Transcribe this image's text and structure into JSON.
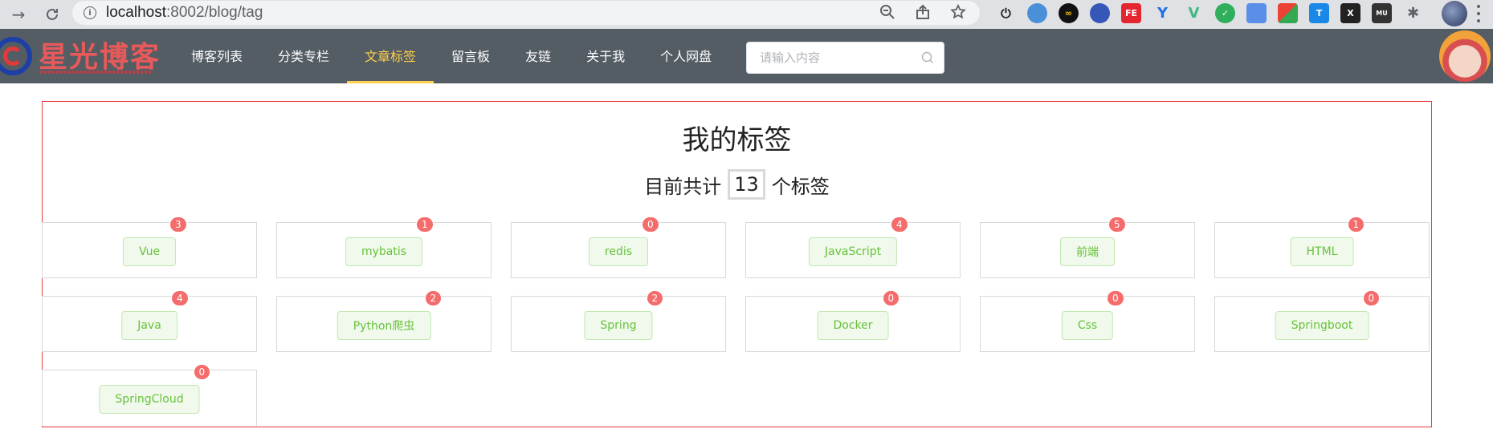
{
  "browser": {
    "url_host": "localhost",
    "url_rest": ":8002/blog/tag"
  },
  "site": {
    "logo_text": "星光博客",
    "nav": [
      {
        "label": "博客列表",
        "active": false
      },
      {
        "label": "分类专栏",
        "active": false
      },
      {
        "label": "文章标签",
        "active": true
      },
      {
        "label": "留言板",
        "active": false
      },
      {
        "label": "友链",
        "active": false
      },
      {
        "label": "关于我",
        "active": false
      },
      {
        "label": "个人网盘",
        "active": false
      }
    ],
    "search_placeholder": "请输入内容",
    "accent_color": "#ffd04b",
    "header_color": "#545c64"
  },
  "tags_page": {
    "title": "我的标签",
    "count_prefix": "目前共计",
    "count": "13",
    "count_suffix": "个标签",
    "tags": [
      {
        "name": "Vue",
        "count": "3"
      },
      {
        "name": "mybatis",
        "count": "1"
      },
      {
        "name": "redis",
        "count": "0"
      },
      {
        "name": "JavaScript",
        "count": "4"
      },
      {
        "name": "前端",
        "count": "5"
      },
      {
        "name": "HTML",
        "count": "1"
      },
      {
        "name": "Java",
        "count": "4"
      },
      {
        "name": "Python爬虫",
        "count": "2"
      },
      {
        "name": "Spring",
        "count": "2"
      },
      {
        "name": "Docker",
        "count": "0"
      },
      {
        "name": "Css",
        "count": "0"
      },
      {
        "name": "Springboot",
        "count": "0"
      },
      {
        "name": "SpringCloud",
        "count": "0"
      }
    ]
  }
}
